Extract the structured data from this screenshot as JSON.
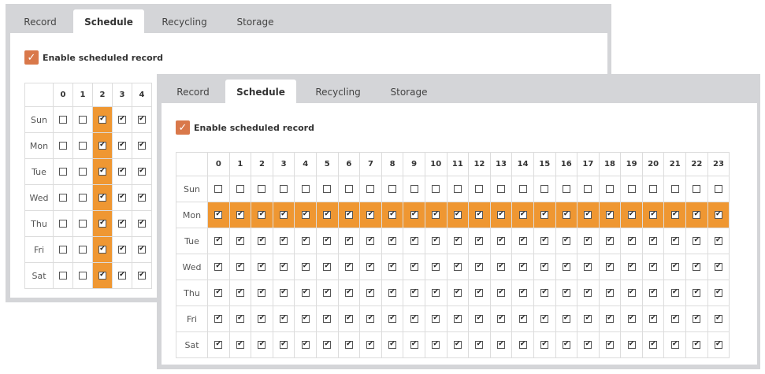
{
  "tabs": [
    "Record",
    "Schedule",
    "Recycling",
    "Storage"
  ],
  "active_tab": "Schedule",
  "enable_label": "Enable scheduled record",
  "days": [
    "Sun",
    "Mon",
    "Tue",
    "Wed",
    "Thu",
    "Fri",
    "Sat"
  ],
  "back_panel": {
    "hours_shown": [
      "0",
      "1",
      "2",
      "3",
      "4"
    ],
    "highlight_hour": 2,
    "checked_hours": [
      2,
      3,
      4
    ]
  },
  "front_panel": {
    "hours_shown": [
      "0",
      "1",
      "2",
      "3",
      "4",
      "5",
      "6",
      "7",
      "8",
      "9",
      "10",
      "11",
      "12",
      "13",
      "14",
      "15",
      "16",
      "17",
      "18",
      "19",
      "20",
      "21",
      "22",
      "23"
    ],
    "highlight_day": "Mon",
    "unchecked_days": [
      "Sun"
    ]
  },
  "colors": {
    "highlight": "#ef9732",
    "enable_check": "#d9784a",
    "frame": "#d4d5d8"
  }
}
